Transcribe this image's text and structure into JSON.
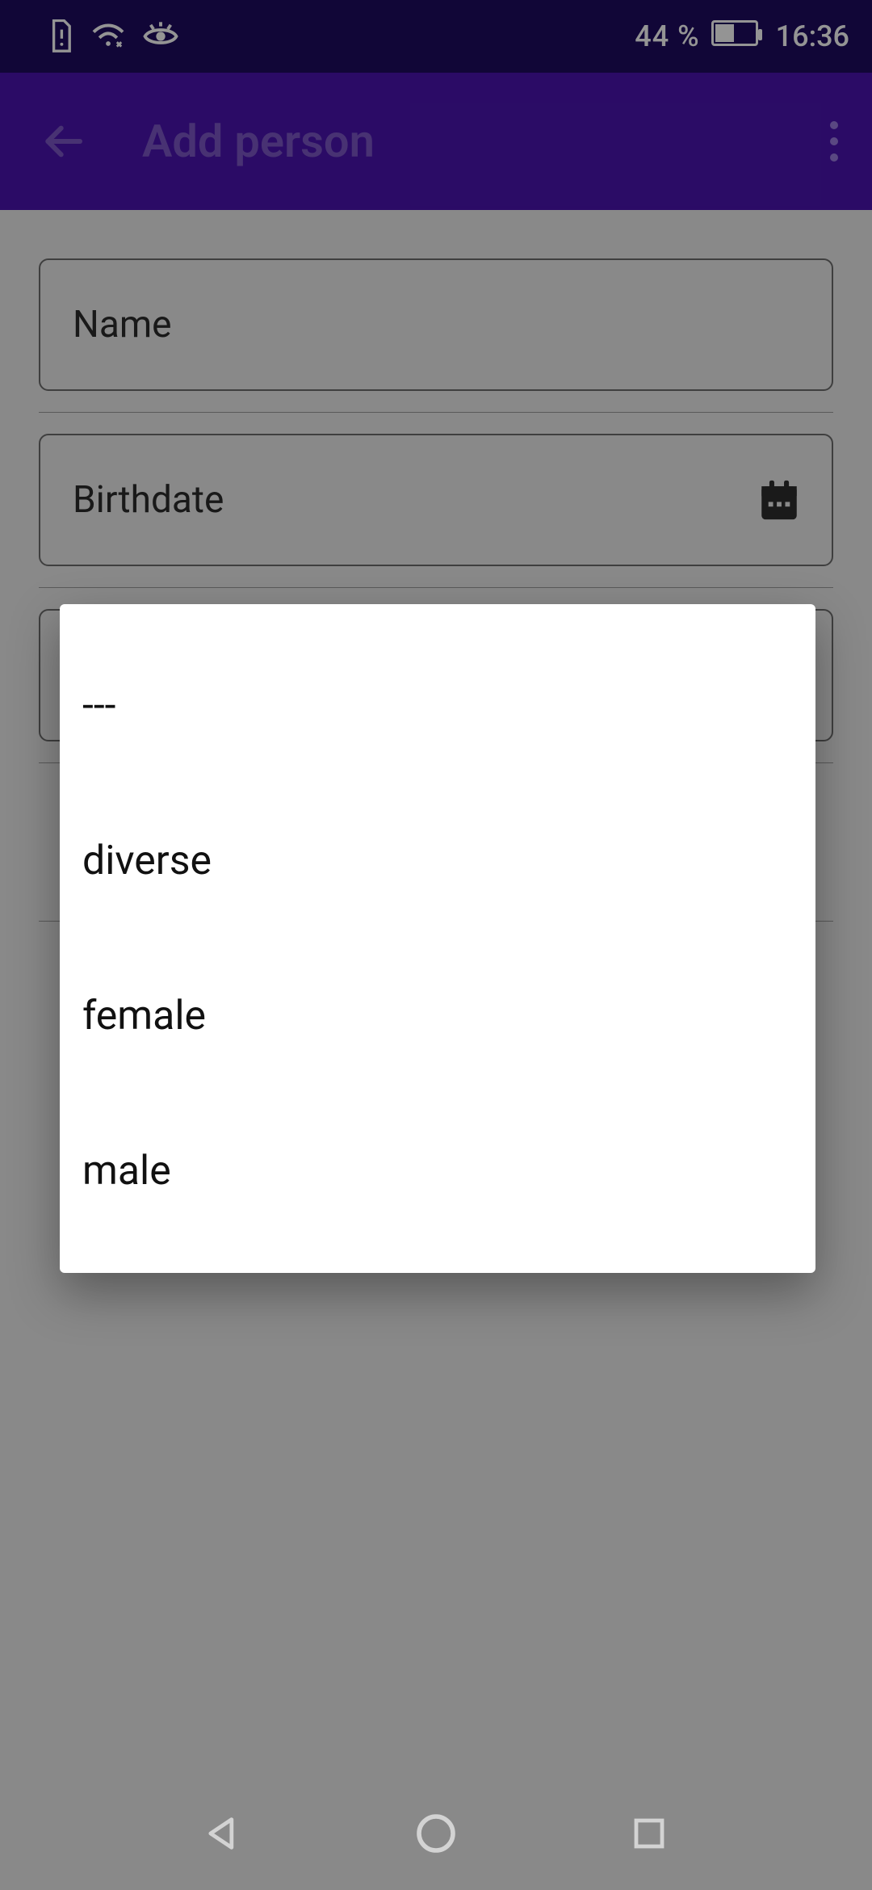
{
  "status": {
    "battery_pct": "44 %",
    "time": "16:36"
  },
  "appbar": {
    "title": "Add person"
  },
  "form": {
    "name_placeholder": "Name",
    "birthdate_placeholder": "Birthdate"
  },
  "gender_options": [
    "---",
    "diverse",
    "female",
    "male"
  ]
}
